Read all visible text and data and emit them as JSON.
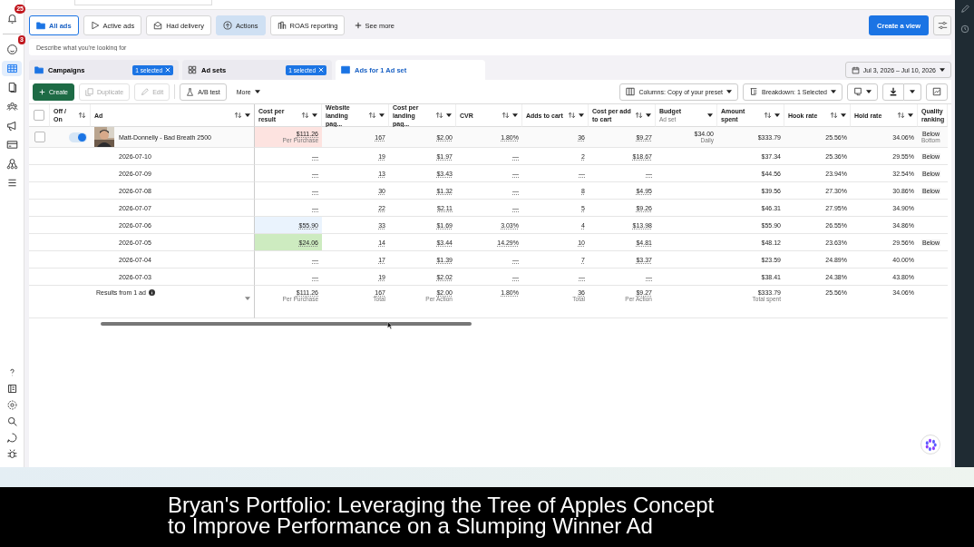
{
  "sidebar": {
    "top_items": [
      {
        "kind": "bell",
        "badge": "25",
        "selected": false
      },
      {
        "kind": "face",
        "badge": "3",
        "selected": false
      },
      {
        "kind": "table",
        "selected": true
      },
      {
        "kind": "pages",
        "selected": false
      },
      {
        "kind": "people",
        "selected": false
      },
      {
        "kind": "megaphone",
        "selected": false
      },
      {
        "kind": "card",
        "selected": false
      },
      {
        "kind": "network",
        "selected": false
      },
      {
        "kind": "menu",
        "selected": false
      }
    ],
    "bottom_items": [
      {
        "kind": "help"
      },
      {
        "kind": "report"
      },
      {
        "kind": "settings"
      },
      {
        "kind": "search"
      },
      {
        "kind": "chat"
      },
      {
        "kind": "bug"
      }
    ]
  },
  "views": [
    {
      "label": "All ads",
      "kind": "folder",
      "selected": true,
      "hovered": false
    },
    {
      "label": "Active ads",
      "kind": "play",
      "selected": false,
      "hovered": false
    },
    {
      "label": "Had delivery",
      "kind": "mail",
      "selected": false,
      "hovered": false
    },
    {
      "label": "Actions",
      "kind": "upload",
      "selected": false,
      "hovered": true
    },
    {
      "label": "ROAS reporting",
      "kind": "chart",
      "selected": false,
      "hovered": false
    }
  ],
  "see_more": "See more",
  "create_view": "Create a view",
  "search": {
    "placeholder": "Describe what you're looking for"
  },
  "levels": [
    {
      "label": "Campaigns",
      "kind": "folder",
      "badge": "1 selected",
      "selected": false
    },
    {
      "label": "Ad sets",
      "kind": "grid",
      "badge": "1 selected",
      "selected": false
    },
    {
      "label": "Ads for 1 Ad set",
      "kind": "ad",
      "selected": true
    }
  ],
  "date_range": "Jul 3, 2026 – Jul 10, 2026",
  "toolbar": [
    {
      "label": "Create",
      "kind": "primary",
      "disabled": false
    },
    {
      "label": "Duplicate",
      "kind": "duplicate",
      "disabled": true
    },
    {
      "label": "Edit",
      "kind": "edit",
      "disabled": true
    },
    {
      "label": "A/B test",
      "kind": "abtest",
      "disabled": false
    },
    {
      "label": "More",
      "kind": "more",
      "disabled": false
    }
  ],
  "columns_button": "Columns: Copy of your preset",
  "breakdown_button": "Breakdown: 1 Selected",
  "table": {
    "all_checked": false,
    "columns": [
      {
        "label": "Off / On",
        "sort": true,
        "menu": false
      },
      {
        "label": "Ad",
        "sort": true,
        "menu": true
      },
      {
        "label": "Cost per result",
        "kind": "link",
        "sort": true,
        "menu": true
      },
      {
        "label": "Website landing pag...",
        "kind": "link",
        "sort": true,
        "menu": true
      },
      {
        "label": "Cost per landing pag...",
        "kind": "link",
        "sort": true,
        "menu": true
      },
      {
        "label": "CVR",
        "kind": "link",
        "sort": true,
        "menu": true
      },
      {
        "label": "Adds to cart",
        "kind": "link",
        "sort": true,
        "menu": true
      },
      {
        "label": "Cost per add to cart",
        "kind": "link",
        "sort": true,
        "menu": true
      },
      {
        "label": "Budget",
        "sub": "Ad set",
        "kind": "plain",
        "sort": false,
        "menu": true
      },
      {
        "label": "Amount spent",
        "kind": "plain",
        "sort": true,
        "menu": true
      },
      {
        "label": "Hook rate",
        "kind": "plain",
        "sort": true,
        "menu": true
      },
      {
        "label": "Hold rate",
        "kind": "plain",
        "sort": true,
        "menu": true
      },
      {
        "label": "Quality ranking",
        "kind": "ranking"
      }
    ],
    "rows": [
      {
        "kind": "ad",
        "checked": false,
        "on": true,
        "name": "Matt-Donnelly - Bad Breath 2500",
        "color": "#fde3e0",
        "cells": [
          {
            "text": "$111.26",
            "sub": "Per Purchase"
          },
          "167",
          "$2.00",
          "1.80%",
          "36",
          "$9.27",
          {
            "text": "$34.00",
            "sub": "Daily"
          },
          "$333.79",
          "25.56%",
          "34.06%",
          {
            "text": "Below",
            "sub": "Bottom"
          }
        ]
      },
      {
        "kind": "day",
        "label": "2026-07-10",
        "cells": [
          "—",
          "19",
          "$1.97",
          "—",
          "2",
          "$18.67",
          null,
          "$37.34",
          "25.36%",
          "29.55%",
          "Below"
        ]
      },
      {
        "kind": "day",
        "label": "2026-07-09",
        "cells": [
          "—",
          "13",
          "$3.43",
          "—",
          "—",
          "—",
          null,
          "$44.56",
          "23.94%",
          "32.54%",
          "Below"
        ]
      },
      {
        "kind": "day",
        "label": "2026-07-08",
        "cells": [
          "—",
          "30",
          "$1.32",
          "—",
          "8",
          "$4.95",
          null,
          "$39.56",
          "27.30%",
          "30.86%",
          "Below"
        ]
      },
      {
        "kind": "day",
        "label": "2026-07-07",
        "cells": [
          "—",
          "22",
          "$2.11",
          "—",
          "5",
          "$9.26",
          null,
          "$46.31",
          "27.95%",
          "34.90%",
          null
        ]
      },
      {
        "kind": "day",
        "label": "2026-07-06",
        "color": "#eaf3fd",
        "cells": [
          "$55.90",
          "33",
          "$1.69",
          "3.03%",
          "4",
          "$13.98",
          null,
          "$55.90",
          "26.55%",
          "34.86%",
          null
        ]
      },
      {
        "kind": "day",
        "label": "2026-07-05",
        "color": "#cdebc0",
        "cells": [
          "$24.06",
          "14",
          "$3.44",
          "14.29%",
          "10",
          "$4.81",
          null,
          "$48.12",
          "23.63%",
          "29.56%",
          "Below"
        ]
      },
      {
        "kind": "day",
        "label": "2026-07-04",
        "cells": [
          "—",
          "17",
          "$1.39",
          "—",
          "7",
          "$3.37",
          null,
          "$23.59",
          "24.89%",
          "40.00%",
          null
        ]
      },
      {
        "kind": "day",
        "label": "2026-07-03",
        "cells": [
          "—",
          "19",
          "$2.02",
          "—",
          "—",
          "—",
          null,
          "$38.41",
          "24.38%",
          "43.80%",
          null
        ]
      },
      {
        "kind": "total",
        "label": "Results from 1 ad",
        "cells": [
          {
            "text": "$111.26",
            "sub": "Per Purchase"
          },
          {
            "text": "167",
            "sub": "Total"
          },
          {
            "text": "$2.00",
            "sub": "Per Action"
          },
          "1.80%",
          {
            "text": "36",
            "sub": "Total"
          },
          {
            "text": "$9.27",
            "sub": "Per Action"
          },
          null,
          {
            "text": "$333.79",
            "sub": "Total spent"
          },
          "25.56%",
          "34.06%",
          null
        ]
      }
    ]
  },
  "caption": [
    "Bryan's Portfolio: Leveraging the Tree of Apples Concept",
    "to Improve Performance on a Slumping Winner Ad"
  ]
}
